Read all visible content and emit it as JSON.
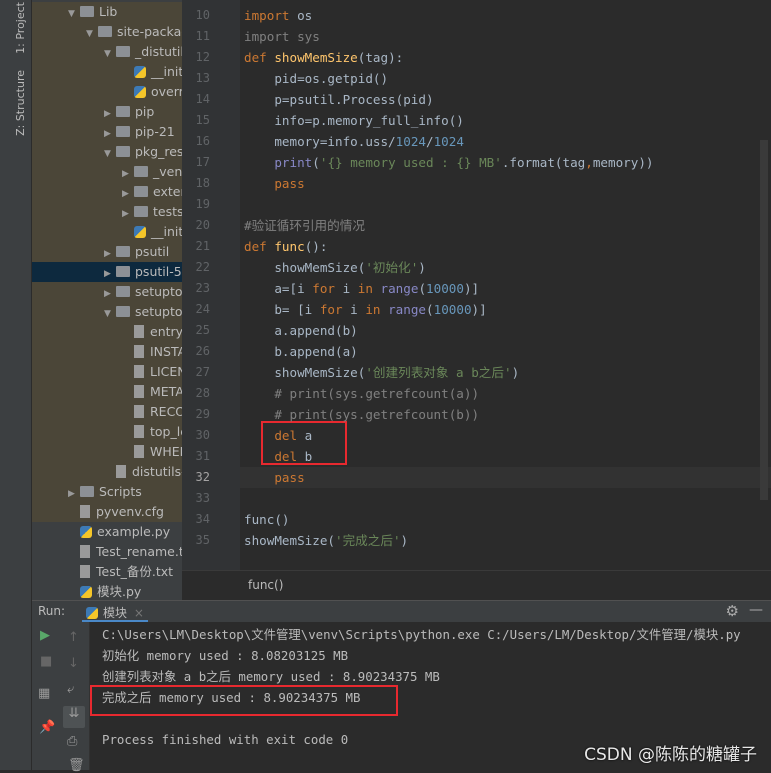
{
  "tool_strip": {
    "project_tab": "1: Project",
    "structure_tab": "Z: Structure"
  },
  "tree": [
    {
      "label": "Lib",
      "indent": 2,
      "arrow": "down",
      "icon": "folder"
    },
    {
      "label": "site-packages",
      "indent": 3,
      "arrow": "down",
      "icon": "folder"
    },
    {
      "label": "_distutils_hack",
      "indent": 4,
      "arrow": "down",
      "icon": "folder"
    },
    {
      "label": "__init__.py",
      "indent": 5,
      "arrow": "",
      "icon": "python"
    },
    {
      "label": "override.py",
      "indent": 5,
      "arrow": "",
      "icon": "python"
    },
    {
      "label": "pip",
      "indent": 4,
      "arrow": "right",
      "icon": "folder"
    },
    {
      "label": "pip-21",
      "indent": 4,
      "arrow": "right",
      "icon": "folder"
    },
    {
      "label": "pkg_resources",
      "indent": 4,
      "arrow": "down",
      "icon": "folder"
    },
    {
      "label": "_vendor",
      "indent": 5,
      "arrow": "right",
      "icon": "folder"
    },
    {
      "label": "extern",
      "indent": 5,
      "arrow": "right",
      "icon": "folder"
    },
    {
      "label": "tests",
      "indent": 5,
      "arrow": "right",
      "icon": "folder"
    },
    {
      "label": "__init__.py",
      "indent": 5,
      "arrow": "",
      "icon": "python"
    },
    {
      "label": "psutil",
      "indent": 4,
      "arrow": "right",
      "icon": "folder"
    },
    {
      "label": "psutil-5",
      "indent": 4,
      "arrow": "right",
      "icon": "folder",
      "selected": true
    },
    {
      "label": "setuptools",
      "indent": 4,
      "arrow": "right",
      "icon": "folder"
    },
    {
      "label": "setuptools-",
      "indent": 4,
      "arrow": "down",
      "icon": "folder"
    },
    {
      "label": "entry_points",
      "indent": 5,
      "arrow": "",
      "icon": "file"
    },
    {
      "label": "INSTALLER",
      "indent": 5,
      "arrow": "",
      "icon": "file"
    },
    {
      "label": "LICENSE",
      "indent": 5,
      "arrow": "",
      "icon": "file"
    },
    {
      "label": "METADATA",
      "indent": 5,
      "arrow": "",
      "icon": "file"
    },
    {
      "label": "RECORD",
      "indent": 5,
      "arrow": "",
      "icon": "file"
    },
    {
      "label": "top_level",
      "indent": 5,
      "arrow": "",
      "icon": "file"
    },
    {
      "label": "WHEEL",
      "indent": 5,
      "arrow": "",
      "icon": "file"
    },
    {
      "label": "distutils-precedence.pth",
      "indent": 4,
      "arrow": "",
      "icon": "file"
    },
    {
      "label": "Scripts",
      "indent": 2,
      "arrow": "right",
      "icon": "folder"
    },
    {
      "label": "pyvenv.cfg",
      "indent": 2,
      "arrow": "",
      "icon": "file"
    },
    {
      "label": "example.py",
      "indent": 2,
      "arrow": "",
      "icon": "python",
      "plain": true
    },
    {
      "label": "Test_rename.txt",
      "indent": 2,
      "arrow": "",
      "icon": "file",
      "plain": true
    },
    {
      "label": "Test_备份.txt",
      "indent": 2,
      "arrow": "",
      "icon": "file",
      "plain": true
    },
    {
      "label": "模块.py",
      "indent": 2,
      "arrow": "",
      "icon": "python",
      "plain": true
    }
  ],
  "code_start_line": 10,
  "current_line": 32,
  "code": [
    [
      [
        "import",
        "kw"
      ],
      [
        " os",
        ""
      ]
    ],
    [
      [
        "import sys",
        "gr"
      ]
    ],
    [
      [
        "def ",
        "kw"
      ],
      [
        "showMemSize",
        "fn"
      ],
      [
        "(tag):",
        ""
      ]
    ],
    [
      [
        "    pid=os.getpid()",
        ""
      ]
    ],
    [
      [
        "    p=psutil.Process(pid)",
        ""
      ]
    ],
    [
      [
        "    info=p.memory_full_info()",
        ""
      ]
    ],
    [
      [
        "    memory=info.uss/",
        ""
      ],
      [
        "1024",
        "nu"
      ],
      [
        "/",
        ""
      ],
      [
        "1024",
        "nu"
      ]
    ],
    [
      [
        "    ",
        ""
      ],
      [
        "print",
        "bi"
      ],
      [
        "(",
        ""
      ],
      [
        "'{} memory used : {} MB'",
        "st"
      ],
      [
        ".format(tag",
        ""
      ],
      [
        ",",
        "kw"
      ],
      [
        "memory))",
        ""
      ]
    ],
    [
      [
        "    ",
        ""
      ],
      [
        "pass",
        "kw"
      ]
    ],
    [
      [
        "",
        ""
      ]
    ],
    [
      [
        "#验证循环引用的情况",
        "cm"
      ]
    ],
    [
      [
        "def ",
        "kw"
      ],
      [
        "func",
        "fn"
      ],
      [
        "():",
        ""
      ]
    ],
    [
      [
        "    showMemSize(",
        ""
      ],
      [
        "'初始化'",
        "st"
      ],
      [
        ")",
        ""
      ]
    ],
    [
      [
        "    a=[i ",
        ""
      ],
      [
        "for",
        "kw"
      ],
      [
        " i ",
        ""
      ],
      [
        "in",
        "kw"
      ],
      [
        " ",
        ""
      ],
      [
        "range",
        "bi"
      ],
      [
        "(",
        ""
      ],
      [
        "10000",
        "nu"
      ],
      [
        ")]",
        ""
      ]
    ],
    [
      [
        "    b= [i ",
        ""
      ],
      [
        "for",
        "kw"
      ],
      [
        " i ",
        ""
      ],
      [
        "in",
        "kw"
      ],
      [
        " ",
        ""
      ],
      [
        "range",
        "bi"
      ],
      [
        "(",
        ""
      ],
      [
        "10000",
        "nu"
      ],
      [
        ")]",
        ""
      ]
    ],
    [
      [
        "    a.append(b)",
        ""
      ]
    ],
    [
      [
        "    b.append(a)",
        ""
      ]
    ],
    [
      [
        "    showMemSize(",
        ""
      ],
      [
        "'创建列表对象 a b之后'",
        "st"
      ],
      [
        ")",
        ""
      ]
    ],
    [
      [
        "    # print(sys.getrefcount(a))",
        "cm"
      ]
    ],
    [
      [
        "    # print(sys.getrefcount(b))",
        "cm"
      ]
    ],
    [
      [
        "    ",
        ""
      ],
      [
        "del",
        "kw"
      ],
      [
        " a",
        ""
      ]
    ],
    [
      [
        "    ",
        ""
      ],
      [
        "del",
        "kw"
      ],
      [
        " b",
        ""
      ]
    ],
    [
      [
        "    ",
        ""
      ],
      [
        "pass",
        "kw"
      ]
    ],
    [
      [
        "",
        ""
      ]
    ],
    [
      [
        "func()",
        ""
      ]
    ],
    [
      [
        "showMemSize(",
        ""
      ],
      [
        "'完成之后'",
        "st"
      ],
      [
        ")",
        ""
      ]
    ]
  ],
  "breadcrumb": "func()",
  "run": {
    "label": "Run:",
    "tab": "模块",
    "close": "×"
  },
  "console": [
    "C:\\Users\\LM\\Desktop\\文件管理\\venv\\Scripts\\python.exe C:/Users/LM/Desktop/文件管理/模块.py",
    "初始化 memory used : 8.08203125 MB",
    "创建列表对象 a b之后 memory used : 8.90234375 MB",
    "完成之后 memory used : 8.90234375 MB",
    "",
    "Process finished with exit code 0"
  ],
  "watermark": "CSDN @陈陈的糖罐子",
  "colors": {
    "highlight_box": "#e8292f",
    "keyword": "#cc7832",
    "string": "#6a8759",
    "number": "#6897bb"
  }
}
